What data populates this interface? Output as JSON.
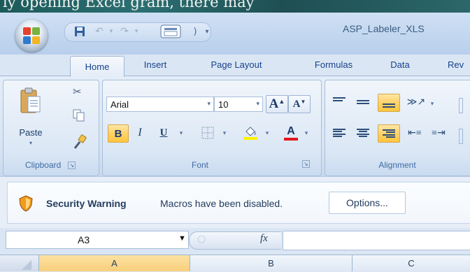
{
  "background": {
    "partial_text": "ly opening Excel gram, there may"
  },
  "titlebar": {
    "title": "ASP_Labeler_XLS"
  },
  "tabs": [
    {
      "label": "Home",
      "active": true
    },
    {
      "label": "Insert"
    },
    {
      "label": "Page Layout"
    },
    {
      "label": "Formulas"
    },
    {
      "label": "Data"
    },
    {
      "label": "Rev"
    }
  ],
  "ribbon": {
    "clipboard": {
      "paste_label": "Paste",
      "group_label": "Clipboard"
    },
    "font": {
      "font_name": "Arial",
      "font_size": "10",
      "group_label": "Font",
      "grow_label": "A",
      "shrink_label": "A",
      "bold": "B",
      "italic": "I",
      "underline": "U",
      "font_color_glyph": "A"
    },
    "alignment": {
      "group_label": "Alignment"
    }
  },
  "security_bar": {
    "title": "Security Warning",
    "message": "Macros have been disabled.",
    "options_label": "Options..."
  },
  "formula_bar": {
    "name_box": "A3",
    "fx_label": "fx"
  },
  "columns": [
    {
      "label": "A",
      "selected": true
    },
    {
      "label": "B"
    },
    {
      "label": "C"
    }
  ],
  "colors": {
    "accent": "#ffc63d",
    "tab_text": "#15428b",
    "font_color_bar": "#e3161d",
    "highlight_bar": "#fff200"
  }
}
